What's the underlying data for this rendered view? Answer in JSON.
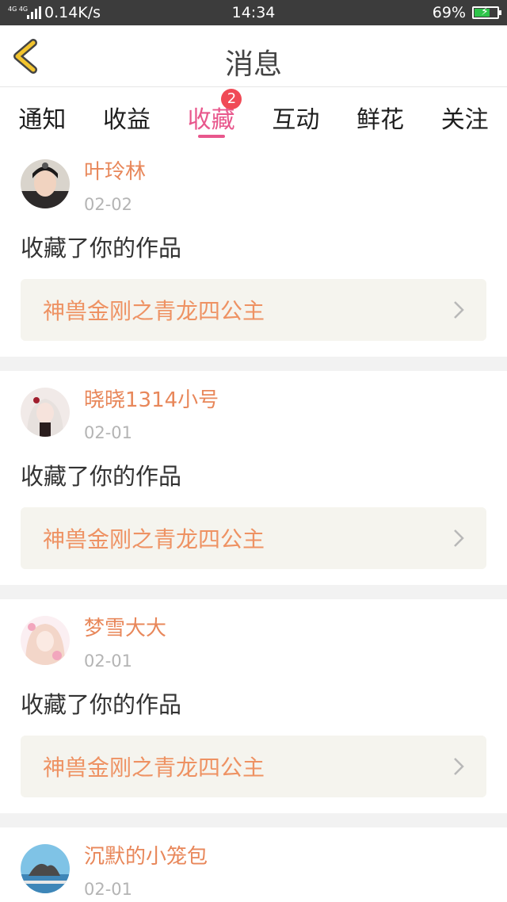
{
  "status_bar": {
    "network_label": "4G 4G",
    "speed": "0.14K/s",
    "time": "14:34",
    "battery_percent": "69%",
    "battery_level": 0.69
  },
  "header": {
    "title": "消息"
  },
  "tabs": [
    {
      "label": "通知"
    },
    {
      "label": "收益"
    },
    {
      "label": "收藏",
      "badge": "2",
      "active": true
    },
    {
      "label": "互动"
    },
    {
      "label": "鲜花"
    },
    {
      "label": "关注"
    }
  ],
  "messages": [
    {
      "user": "叶玲林",
      "date": "02-02",
      "action": "收藏了你的作品",
      "work_title": "神兽金刚之青龙四公主",
      "avatar": "avatar-1"
    },
    {
      "user": "晓晓1314小号",
      "date": "02-01",
      "action": "收藏了你的作品",
      "work_title": "神兽金刚之青龙四公主",
      "avatar": "avatar-2"
    },
    {
      "user": "梦雪大大",
      "date": "02-01",
      "action": "收藏了你的作品",
      "work_title": "神兽金刚之青龙四公主",
      "avatar": "avatar-3"
    },
    {
      "user": "沉默的小笼包",
      "date": "02-01",
      "avatar": "avatar-4"
    }
  ],
  "colors": {
    "accent": "#e8578c",
    "username": "#e8875a",
    "work_title": "#ee9263",
    "back_arrow": "#f2c42e",
    "badge": "#f04a56"
  }
}
